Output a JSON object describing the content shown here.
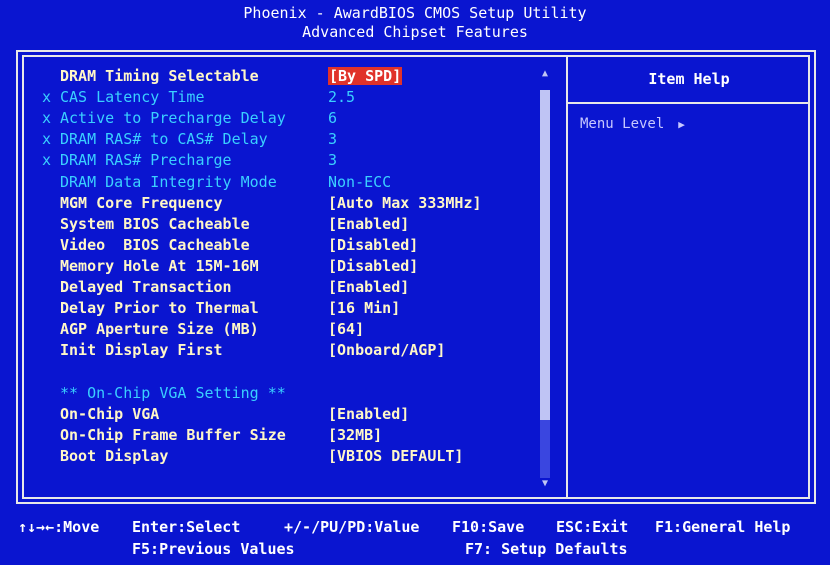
{
  "header": {
    "title": "Phoenix - AwardBIOS CMOS Setup Utility",
    "subtitle": "Advanced Chipset Features"
  },
  "items": [
    {
      "label": "DRAM Timing Selectable",
      "value": "[By SPD]",
      "state": "enabled",
      "locked": false,
      "selected": true
    },
    {
      "label": "CAS Latency Time",
      "value": "2.5",
      "state": "disabled",
      "locked": true,
      "selected": false
    },
    {
      "label": "Active to Precharge Delay",
      "value": "6",
      "state": "disabled",
      "locked": true,
      "selected": false
    },
    {
      "label": "DRAM RAS# to CAS# Delay",
      "value": "3",
      "state": "disabled",
      "locked": true,
      "selected": false
    },
    {
      "label": "DRAM RAS# Precharge",
      "value": "3",
      "state": "disabled",
      "locked": true,
      "selected": false
    },
    {
      "label": "DRAM Data Integrity Mode",
      "value": "Non-ECC",
      "state": "dim",
      "locked": false,
      "selected": false
    },
    {
      "label": "MGM Core Frequency",
      "value": "[Auto Max 333MHz]",
      "state": "enabled",
      "locked": false,
      "selected": false
    },
    {
      "label": "System BIOS Cacheable",
      "value": "[Enabled]",
      "state": "enabled",
      "locked": false,
      "selected": false
    },
    {
      "label": "Video  BIOS Cacheable",
      "value": "[Disabled]",
      "state": "enabled",
      "locked": false,
      "selected": false
    },
    {
      "label": "Memory Hole At 15M-16M",
      "value": "[Disabled]",
      "state": "enabled",
      "locked": false,
      "selected": false
    },
    {
      "label": "Delayed Transaction",
      "value": "[Enabled]",
      "state": "enabled",
      "locked": false,
      "selected": false
    },
    {
      "label": "Delay Prior to Thermal",
      "value": "[16 Min]",
      "state": "enabled",
      "locked": false,
      "selected": false
    },
    {
      "label": "AGP Aperture Size (MB)",
      "value": "[64]",
      "state": "enabled",
      "locked": false,
      "selected": false
    },
    {
      "label": "Init Display First",
      "value": "[Onboard/AGP]",
      "state": "enabled",
      "locked": false,
      "selected": false
    },
    {
      "label": "",
      "value": "",
      "state": "blank",
      "locked": false,
      "selected": false
    },
    {
      "label": "** On-Chip VGA Setting **",
      "value": "",
      "state": "heading",
      "locked": false,
      "selected": false
    },
    {
      "label": "On-Chip VGA",
      "value": "[Enabled]",
      "state": "enabled",
      "locked": false,
      "selected": false
    },
    {
      "label": "On-Chip Frame Buffer Size",
      "value": "[32MB]",
      "state": "enabled",
      "locked": false,
      "selected": false
    },
    {
      "label": "Boot Display",
      "value": "[VBIOS DEFAULT]",
      "state": "enabled",
      "locked": false,
      "selected": false
    }
  ],
  "locked_marker": "x",
  "help": {
    "title": "Item Help",
    "menu_level_label": "Menu Level",
    "menu_level_arrow": "▶"
  },
  "scrollbar": {
    "up_arrow": "▲",
    "down_arrow": "▼"
  },
  "footer": {
    "move": "↑↓→←:Move",
    "enter": "Enter:Select",
    "value": "+/-/PU/PD:Value",
    "save": "F10:Save",
    "exit": "ESC:Exit",
    "help": "F1:General Help",
    "prev": "F5:Previous Values",
    "defaults": "F7: Setup Defaults"
  },
  "colors": {
    "background": "#0a15d0",
    "enabled_text": "#fff7c8",
    "disabled_text": "#3ad0ff",
    "selection": "#e0322a"
  }
}
